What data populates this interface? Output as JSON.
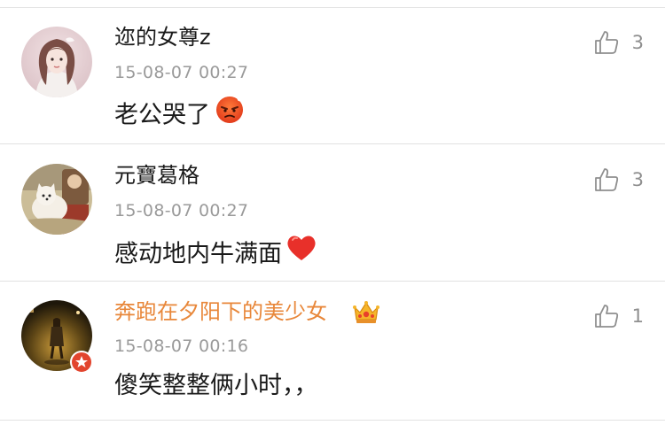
{
  "comments": [
    {
      "username": "迩的女尊z",
      "timestamp": "15-08-07 00:27",
      "content": "老公哭了",
      "likes": "3",
      "emoji": "angry-face-emoji",
      "avatar_colors": [
        "#e9d2d6",
        "#c8a4a8"
      ]
    },
    {
      "username": "元寶葛格",
      "timestamp": "15-08-07 00:27",
      "content": "感动地内牛满面",
      "likes": "3",
      "emoji": "red-heart-emoji",
      "avatar_colors": [
        "#cdbf9a",
        "#7f6a48"
      ]
    },
    {
      "username": "奔跑在夕阳下的美少女",
      "timestamp": "15-08-07 00:16",
      "content": "傻笑整整俩小时，，",
      "likes": "1",
      "username_color": "#e8873a",
      "badge": "vip-crown-icon",
      "avatar_colors": [
        "#3a2d12",
        "#c79a34"
      ]
    }
  ],
  "colors": {
    "text": "#1a1a1a",
    "meta": "#9a9a9a",
    "divider": "#e2e2e2",
    "vip_name": "#e8873a"
  }
}
